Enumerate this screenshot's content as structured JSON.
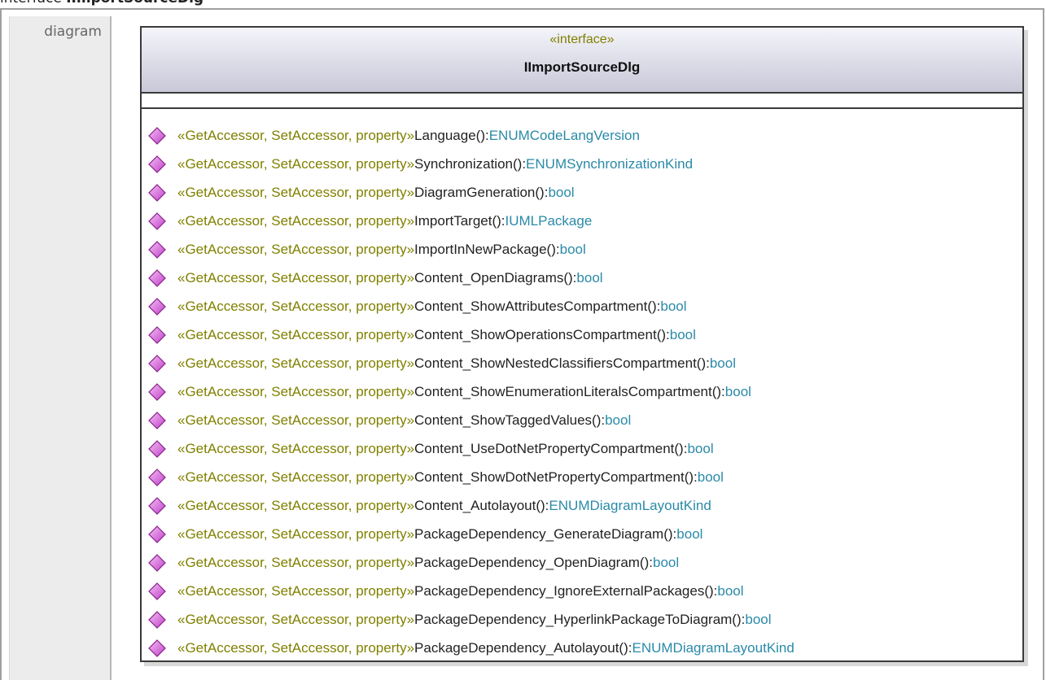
{
  "page": {
    "title_prefix": "interface",
    "title_name": "IImportSourceDlg"
  },
  "frame": {
    "label": "diagram"
  },
  "uml_class": {
    "stereotype": "«interface»",
    "name": "IImportSourceDlg",
    "operations": [
      {
        "stereotype": "«GetAccessor, SetAccessor, property»",
        "name": "Language():",
        "type": "ENUMCodeLangVersion"
      },
      {
        "stereotype": "«GetAccessor, SetAccessor, property»",
        "name": "Synchronization():",
        "type": "ENUMSynchronizationKind"
      },
      {
        "stereotype": "«GetAccessor, SetAccessor, property»",
        "name": "DiagramGeneration():",
        "type": "bool"
      },
      {
        "stereotype": "«GetAccessor, SetAccessor, property»",
        "name": "ImportTarget():",
        "type": "IUMLPackage"
      },
      {
        "stereotype": "«GetAccessor, SetAccessor, property»",
        "name": "ImportInNewPackage():",
        "type": "bool"
      },
      {
        "stereotype": "«GetAccessor, SetAccessor, property»",
        "name": "Content_OpenDiagrams():",
        "type": "bool"
      },
      {
        "stereotype": "«GetAccessor, SetAccessor, property»",
        "name": "Content_ShowAttributesCompartment():",
        "type": "bool"
      },
      {
        "stereotype": "«GetAccessor, SetAccessor, property»",
        "name": "Content_ShowOperationsCompartment():",
        "type": "bool"
      },
      {
        "stereotype": "«GetAccessor, SetAccessor, property»",
        "name": "Content_ShowNestedClassifiersCompartment():",
        "type": "bool"
      },
      {
        "stereotype": "«GetAccessor, SetAccessor, property»",
        "name": "Content_ShowEnumerationLiteralsCompartment():",
        "type": "bool"
      },
      {
        "stereotype": "«GetAccessor, SetAccessor, property»",
        "name": "Content_ShowTaggedValues():",
        "type": "bool"
      },
      {
        "stereotype": "«GetAccessor, SetAccessor, property»",
        "name": "Content_UseDotNetPropertyCompartment():",
        "type": "bool"
      },
      {
        "stereotype": "«GetAccessor, SetAccessor, property»",
        "name": "Content_ShowDotNetPropertyCompartment():",
        "type": "bool"
      },
      {
        "stereotype": "«GetAccessor, SetAccessor, property»",
        "name": "Content_Autolayout():",
        "type": "ENUMDiagramLayoutKind"
      },
      {
        "stereotype": "«GetAccessor, SetAccessor, property»",
        "name": "PackageDependency_GenerateDiagram():",
        "type": "bool"
      },
      {
        "stereotype": "«GetAccessor, SetAccessor, property»",
        "name": "PackageDependency_OpenDiagram():",
        "type": "bool"
      },
      {
        "stereotype": "«GetAccessor, SetAccessor, property»",
        "name": "PackageDependency_IgnoreExternalPackages():",
        "type": "bool"
      },
      {
        "stereotype": "«GetAccessor, SetAccessor, property»",
        "name": "PackageDependency_HyperlinkPackageToDiagram():",
        "type": "bool"
      },
      {
        "stereotype": "«GetAccessor, SetAccessor, property»",
        "name": "PackageDependency_Autolayout():",
        "type": "ENUMDiagramLayoutKind"
      }
    ]
  },
  "colors": {
    "stereotype": "#808000",
    "type_link": "#2a8aa8",
    "operation_icon": "#c040c8"
  },
  "icons": {
    "operation": "operation-diamond-icon"
  }
}
